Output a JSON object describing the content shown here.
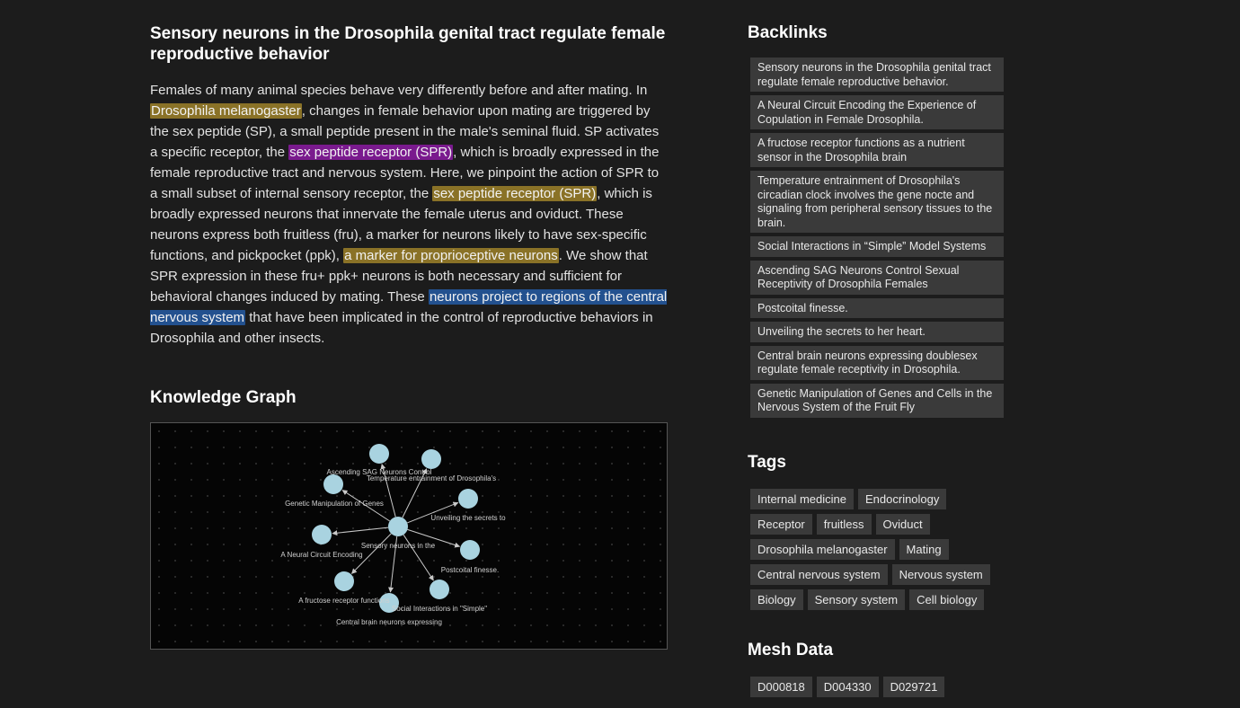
{
  "article": {
    "title": "Sensory neurons in the Drosophila genital tract regulate female reproductive behavior",
    "abstract": [
      {
        "text": "Females of many animal species behave very differently before and after mating. In ",
        "hl": ""
      },
      {
        "text": "Drosophila melanogaster",
        "hl": "gold"
      },
      {
        "text": ", changes in female behavior upon mating are triggered by the sex peptide (SP), a small peptide present in the male's seminal fluid. SP activates a specific receptor, the ",
        "hl": ""
      },
      {
        "text": "sex peptide receptor (SPR)",
        "hl": "purple"
      },
      {
        "text": ", which is broadly expressed in the female reproductive tract and nervous system. Here, we pinpoint the action of SPR to a small subset of internal sensory receptor, the ",
        "hl": ""
      },
      {
        "text": "sex peptide receptor (SPR)",
        "hl": "gold"
      },
      {
        "text": ", which is broadly expressed neurons that innervate the female uterus and oviduct. These neurons express both fruitless (fru), a marker for neurons likely to have sex-specific functions, and pickpocket (ppk), ",
        "hl": ""
      },
      {
        "text": "a marker for proprioceptive neurons",
        "hl": "gold"
      },
      {
        "text": ". We show that SPR expression in these fru+ ppk+ neurons is both necessary and sufficient for behavioral changes induced by mating. These ",
        "hl": ""
      },
      {
        "text": "neurons project to regions of the central nervous system",
        "hl": "blue"
      },
      {
        "text": " that have been implicated in the control of reproductive behaviors in Drosophila and other insects.",
        "hl": ""
      }
    ]
  },
  "knowledge_graph": {
    "title": "Knowledge Graph",
    "center_label": "Sensory neurons in the",
    "nodes": [
      {
        "label": "Ascending SAG Neurons Control"
      },
      {
        "label": "Temperature entrainment of Drosophila's"
      },
      {
        "label": "Genetic Manipulation of Genes"
      },
      {
        "label": "Unveiling the secrets to"
      },
      {
        "label": "A Neural Circuit Encoding"
      },
      {
        "label": "Postcoital finesse."
      },
      {
        "label": "A fructose receptor functions"
      },
      {
        "label": "Social Interactions in \"Simple\""
      },
      {
        "label": "Central brain neurons expressing"
      }
    ],
    "colors": {
      "node": "#a9d3e0",
      "edge": "#c8c8c8",
      "label": "#d0d0d0"
    }
  },
  "backlinks": {
    "title": "Backlinks",
    "items": [
      "Sensory neurons in the Drosophila genital tract regulate female reproductive behavior.",
      "A Neural Circuit Encoding the Experience of Copulation in Female Drosophila.",
      "A fructose receptor functions as a nutrient sensor in the Drosophila brain",
      "Temperature entrainment of Drosophila's circadian clock involves the gene nocte and signaling from peripheral sensory tissues to the brain.",
      "Social Interactions in “Simple” Model Systems",
      "Ascending SAG Neurons Control Sexual Receptivity of Drosophila Females",
      "Postcoital finesse.",
      "Unveiling the secrets to her heart.",
      "Central brain neurons expressing doublesex regulate female receptivity in Drosophila.",
      "Genetic Manipulation of Genes and Cells in the Nervous System of the Fruit Fly"
    ]
  },
  "tags": {
    "title": "Tags",
    "rows": [
      [
        "Internal medicine",
        "Endocrinology"
      ],
      [
        "Receptor",
        "fruitless",
        "Oviduct"
      ],
      [
        "Drosophila melanogaster",
        "Mating"
      ],
      [
        "Central nervous system",
        "Nervous system"
      ],
      [
        "Biology",
        "Sensory system",
        "Cell biology"
      ]
    ]
  },
  "mesh": {
    "title": "Mesh Data",
    "rows": [
      [
        "D000818",
        "D004330",
        "D029721"
      ]
    ]
  }
}
